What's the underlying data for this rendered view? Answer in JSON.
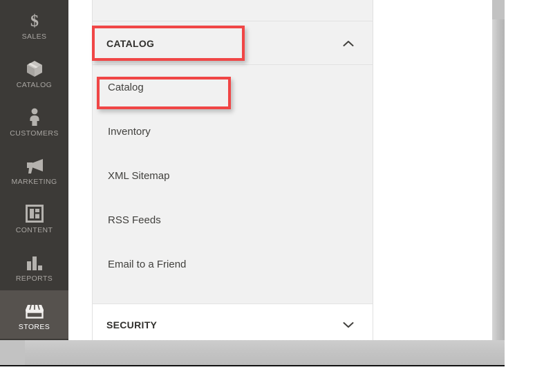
{
  "sidebar": {
    "items": [
      {
        "label": "SALES",
        "icon": "dollar-icon",
        "active": false
      },
      {
        "label": "CATALOG",
        "icon": "box-icon",
        "active": false
      },
      {
        "label": "CUSTOMERS",
        "icon": "person-icon",
        "active": false
      },
      {
        "label": "MARKETING",
        "icon": "megaphone-icon",
        "active": false
      },
      {
        "label": "CONTENT",
        "icon": "layout-icon",
        "active": false
      },
      {
        "label": "REPORTS",
        "icon": "bar-chart-icon",
        "active": false
      },
      {
        "label": "STORES",
        "icon": "store-icon",
        "active": true
      }
    ]
  },
  "panel": {
    "sections": [
      {
        "title": "CATALOG",
        "expanded": true,
        "chevron": "chevron-up-icon",
        "items": [
          {
            "label": "Catalog"
          },
          {
            "label": "Inventory"
          },
          {
            "label": "XML Sitemap"
          },
          {
            "label": "RSS Feeds"
          },
          {
            "label": "Email to a Friend"
          }
        ]
      },
      {
        "title": "SECURITY",
        "expanded": false,
        "chevron": "chevron-down-icon",
        "items": []
      }
    ]
  },
  "annotations": {
    "color": "#f04646",
    "boxes": [
      {
        "target": "CATALOG section header"
      },
      {
        "target": "Catalog menu item"
      }
    ]
  },
  "theme": {
    "sidebar_bg": "#3c3a37",
    "sidebar_active_bg": "#56524e",
    "panel_bg": "#f1f1f1",
    "panel_collapsed_bg": "#ffffff",
    "frame_gray": "#c2c2c2",
    "text_dark": "#31302d"
  }
}
